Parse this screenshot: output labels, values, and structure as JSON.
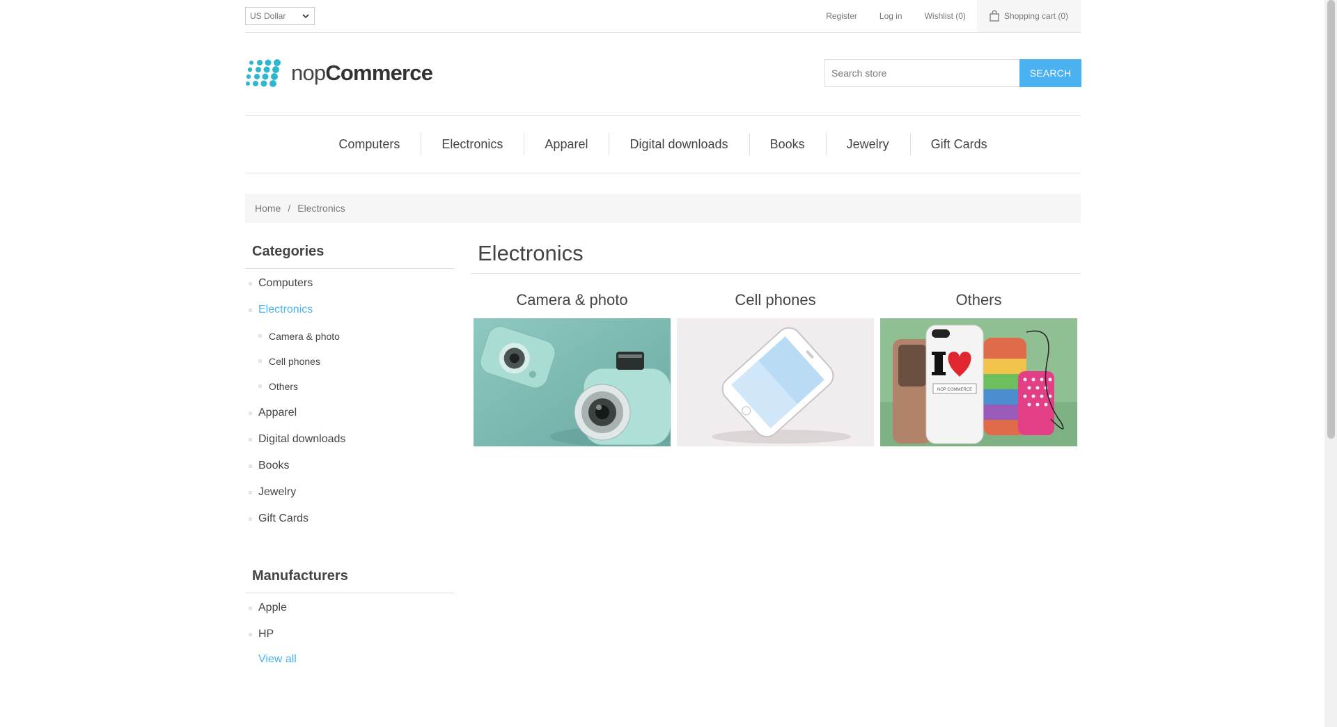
{
  "header": {
    "currency": "US Dollar",
    "links": {
      "register": "Register",
      "login": "Log in",
      "wishlist": "Wishlist (0)",
      "cart": "Shopping cart (0)"
    }
  },
  "logo": {
    "light": "nop",
    "bold": "Commerce"
  },
  "search": {
    "placeholder": "Search store",
    "button": "Search"
  },
  "menu": [
    "Computers",
    "Electronics",
    "Apparel",
    "Digital downloads",
    "Books",
    "Jewelry",
    "Gift Cards"
  ],
  "breadcrumb": {
    "home": "Home",
    "separator": "/",
    "current": "Electronics"
  },
  "sidebar": {
    "categories_title": "Categories",
    "categories": [
      "Computers",
      "Electronics",
      "Apparel",
      "Digital downloads",
      "Books",
      "Jewelry",
      "Gift Cards"
    ],
    "subcategories": [
      "Camera & photo",
      "Cell phones",
      "Others"
    ],
    "manufacturers_title": "Manufacturers",
    "manufacturers": [
      "Apple",
      "HP"
    ],
    "view_all": "View all"
  },
  "main": {
    "title": "Electronics",
    "subcategories": [
      {
        "title": "Camera & photo"
      },
      {
        "title": "Cell phones"
      },
      {
        "title": "Others"
      }
    ],
    "phone_case_text": "NOP COMMERCE"
  },
  "colors": {
    "accent": "#4ab2f1",
    "text": "#444444",
    "border": "#dddddd",
    "muted": "#f6f6f6"
  }
}
